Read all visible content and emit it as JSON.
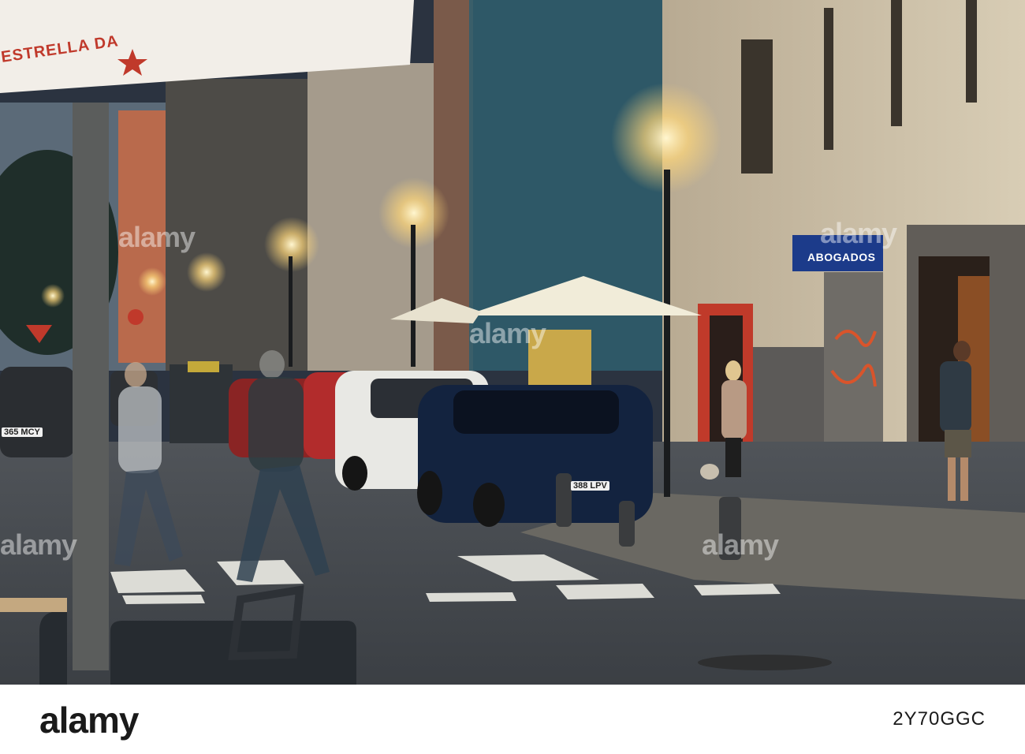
{
  "photo": {
    "description_icon": "night-street-photo",
    "signs": {
      "lawyer_sign": "ABOGADOS",
      "umbrella_brand": "ESTRELLA DA"
    },
    "plates": {
      "left_car": "365 MCY",
      "blue_car": "388 LPV"
    },
    "watermark_text": "alamy"
  },
  "banner": {
    "logo": "alamy",
    "image_id": "2Y70GGC"
  },
  "colors": {
    "sky": "#2b3340",
    "street": "#4a4f55",
    "lamp_glow": "#ffe9a8",
    "sign_blue": "#1c3b8a",
    "car_blue": "#13233f"
  }
}
